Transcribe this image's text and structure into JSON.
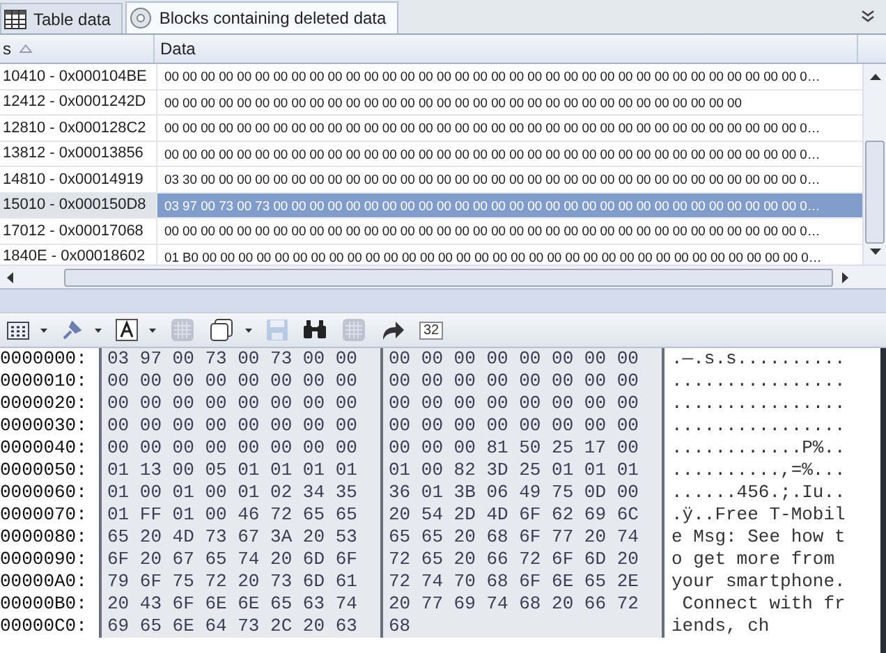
{
  "tabs": [
    {
      "label": "Table data",
      "kind": "table",
      "selected": false
    },
    {
      "label": "Blocks containing deleted data",
      "kind": "blocks",
      "selected": true
    }
  ],
  "grid": {
    "columns": [
      "s",
      "Data"
    ],
    "rows": [
      {
        "address": "10410 - 0x000104BE",
        "data": "00 00 00 00 00 00 00 00 00 00 00 00 00 00 00 00 00 00 00 00 00 00 00 00 00 00 00 00 00 00 00 00 00 00 00 0…",
        "selected": false
      },
      {
        "address": "12412 - 0x0001242D",
        "data": "00 00 00 00 00 00 00 00 00 00 00 00 00 00 00 00 00 00 00 00 00 00 00 00 00 00 00 00 00 00 00 00",
        "selected": false
      },
      {
        "address": "12810 - 0x000128C2",
        "data": "00 00 00 00 00 00 00 00 00 00 00 00 00 00 00 00 00 00 00 00 00 00 00 00 00 00 00 00 00 00 00 00 00 00 00 0…",
        "selected": false
      },
      {
        "address": "13812 - 0x00013856",
        "data": "00 00 00 00 00 00 00 00 00 00 00 00 00 00 00 00 00 00 00 00 00 00 00 00 00 00 00 00 00 00 00 00 00 00 00 0…",
        "selected": false
      },
      {
        "address": "14810 - 0x00014919",
        "data": "03 30 00 00 00 00 00 00 00 00 00 00 00 00 00 00 00 00 00 00 00 00 00 00 00 00 00 00 00 00 00 00 00 00 00 0…",
        "selected": false
      },
      {
        "address": "15010 - 0x000150D8",
        "data": "03 97 00 73 00 73 00 00 00 00 00 00 00 00 00 00 00 00 00 00 00 00 00 00 00 00 00 00 00 00 00 00 00 00 00 0…",
        "selected": true
      },
      {
        "address": "17012 - 0x00017068",
        "data": "00 00 00 00 00 00 00 00 00 00 00 00 00 00 00 00 00 00 00 00 00 00 00 00 00 00 00 00 00 00 00 00 00 00 00 0…",
        "selected": false
      },
      {
        "address": "1840E - 0x00018602",
        "data": "01 B0 00 00 00 00 00 00 00 00 00 00 00 00 00 00 00 00 00 00 00 00 00 00 00 00 00 00 00 00 00 00 00 00 00 0…",
        "selected": false
      }
    ]
  },
  "toolbar": [
    {
      "kind": "grid",
      "dropdown": true,
      "disabled": false
    },
    {
      "kind": "pin",
      "dropdown": true,
      "disabled": false
    },
    {
      "kind": "font",
      "dropdown": true,
      "disabled": false
    },
    {
      "kind": "pattern",
      "dropdown": false,
      "disabled": true
    },
    {
      "kind": "pages",
      "dropdown": true,
      "disabled": false
    },
    {
      "kind": "save",
      "dropdown": false,
      "disabled": true
    },
    {
      "kind": "binoculars",
      "dropdown": false,
      "disabled": false
    },
    {
      "kind": "pattern",
      "dropdown": false,
      "disabled": true
    },
    {
      "kind": "redo",
      "dropdown": false,
      "disabled": false
    },
    {
      "kind": "text",
      "label": "32",
      "dropdown": false,
      "disabled": false
    }
  ],
  "hex": [
    {
      "offset": "0000000:",
      "group_1": "03 97 00 73 00 73 00 00",
      "group_2": "00 00 00 00 00 00 00 00",
      "ascii": ".—.s.s.........."
    },
    {
      "offset": "0000010:",
      "group_1": "00 00 00 00 00 00 00 00",
      "group_2": "00 00 00 00 00 00 00 00",
      "ascii": "................"
    },
    {
      "offset": "0000020:",
      "group_1": "00 00 00 00 00 00 00 00",
      "group_2": "00 00 00 00 00 00 00 00",
      "ascii": "................"
    },
    {
      "offset": "0000030:",
      "group_1": "00 00 00 00 00 00 00 00",
      "group_2": "00 00 00 00 00 00 00 00",
      "ascii": "................"
    },
    {
      "offset": "0000040:",
      "group_1": "00 00 00 00 00 00 00 00",
      "group_2": "00 00 00 81 50 25 17 00",
      "ascii": "............P%.."
    },
    {
      "offset": "0000050:",
      "group_1": "01 13 00 05 01 01 01 01",
      "group_2": "01 00 82 3D 25 01 01 01",
      "ascii": "..........,=%..."
    },
    {
      "offset": "0000060:",
      "group_1": "01 00 01 00 01 02 34 35",
      "group_2": "36 01 3B 06 49 75 0D 00",
      "ascii": "......456.;.Iu.."
    },
    {
      "offset": "0000070:",
      "group_1": "01 FF 01 00 46 72 65 65",
      "group_2": "20 54 2D 4D 6F 62 69 6C",
      "ascii": ".ÿ..Free T-Mobil"
    },
    {
      "offset": "0000080:",
      "group_1": "65 20 4D 73 67 3A 20 53",
      "group_2": "65 65 20 68 6F 77 20 74",
      "ascii": "e Msg: See how t"
    },
    {
      "offset": "0000090:",
      "group_1": "6F 20 67 65 74 20 6D 6F",
      "group_2": "72 65 20 66 72 6F 6D 20",
      "ascii": "o get more from "
    },
    {
      "offset": "00000A0:",
      "group_1": "79 6F 75 72 20 73 6D 61",
      "group_2": "72 74 70 68 6F 6E 65 2E",
      "ascii": "your smartphone."
    },
    {
      "offset": "00000B0:",
      "group_1": "20 43 6F 6E 6E 65 63 74",
      "group_2": "20 77 69 74 68 20 66 72",
      "ascii": " Connect with fr"
    },
    {
      "offset": "00000C0:",
      "group_1": "69 65 6E 64 73 2C 20 63",
      "group_2": "68",
      "ascii": "iends, ch"
    }
  ]
}
